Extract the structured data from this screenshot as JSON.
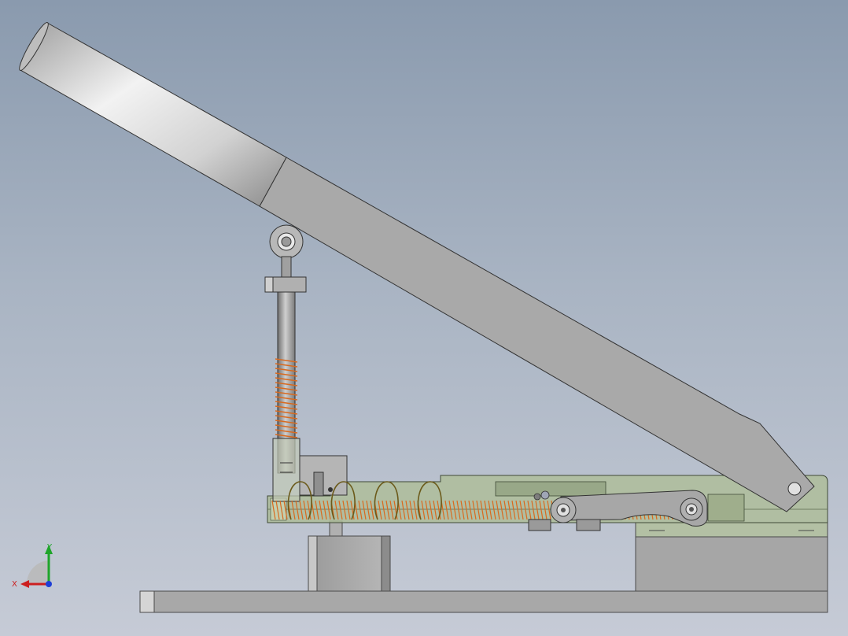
{
  "viewport": {
    "background_top": "#8a9aae",
    "background_bottom": "#c6cbd6"
  },
  "axis_triad": {
    "x_label": "X",
    "y_label": "Y",
    "x_color": "#cc1f1f",
    "y_color": "#1fa52a",
    "z_color": "#1f3fd6"
  },
  "colors": {
    "handle_grip": "#dcdcdc",
    "lever_arm": "#a9a9a9",
    "base_plate": "#a7a7a7",
    "green_body": "#aebd9a",
    "spring": "#d96a1f"
  }
}
